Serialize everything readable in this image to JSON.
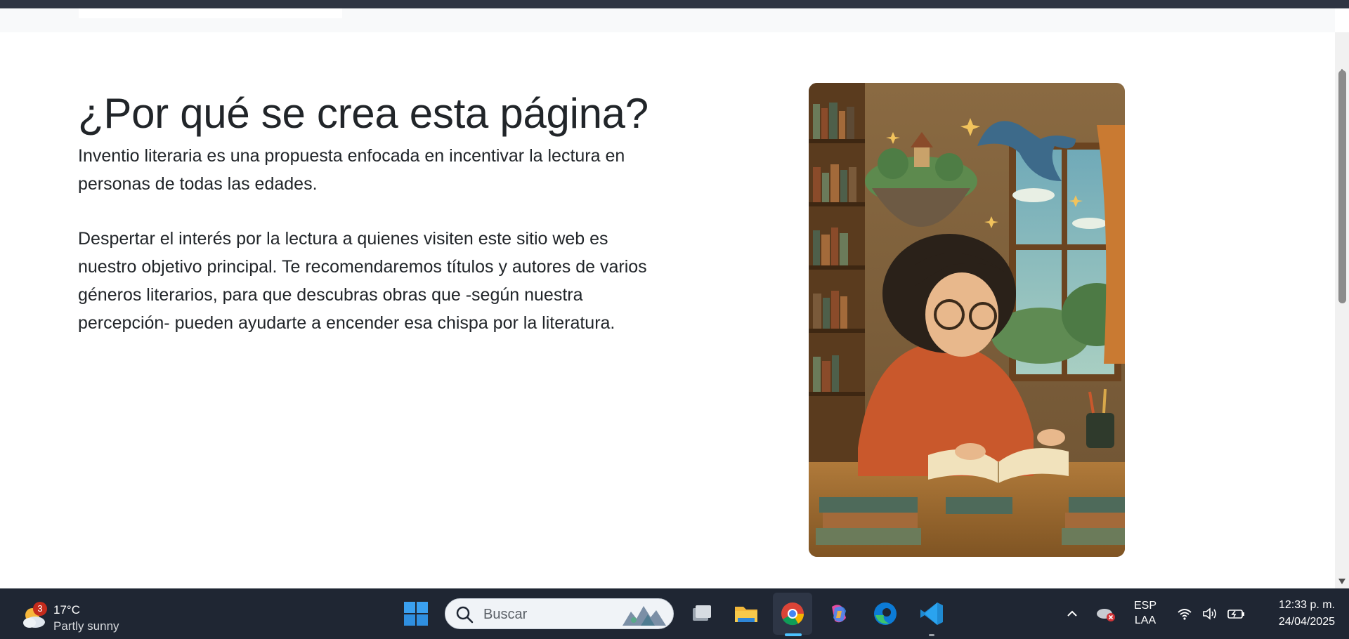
{
  "page": {
    "heading": "¿Por qué se crea esta página?",
    "paragraph1": "Inventio literaria es una propuesta enfocada en incentivar la lectura en personas de todas las edades.",
    "paragraph2": "Despertar el interés por la lectura a quienes visiten este sitio web es nuestro objetivo principal. Te recomendaremos títulos y autores de varios géneros literarios, para que descubras obras que -según nuestra percepción- pueden ayudarte a encender esa chispa por la literatura.",
    "illustration_icon": "reading-girl-illustration"
  },
  "colors": {
    "text": "#212529",
    "taskbar": "#1f2633",
    "accent": "#4cc2ff"
  },
  "taskbar": {
    "weather": {
      "badge": "3",
      "temperature": "17°C",
      "description": "Partly sunny",
      "icon": "partly-sunny-icon"
    },
    "search": {
      "placeholder": "Buscar"
    },
    "apps": [
      "start",
      "task-view",
      "file-explorer",
      "chrome",
      "copilot",
      "edge",
      "vscode"
    ],
    "language": {
      "line1": "ESP",
      "line2": "LAA"
    },
    "clock": {
      "time": "12:33 p. m.",
      "date": "24/04/2025"
    }
  }
}
